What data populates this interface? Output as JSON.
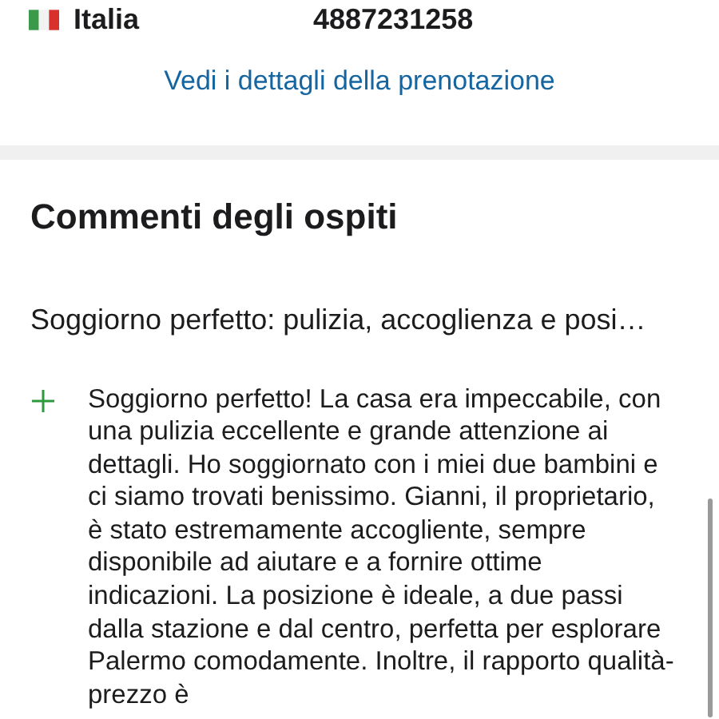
{
  "contact": {
    "country": "Italia",
    "phone": "4887231258"
  },
  "booking_link": "Vedi i dettagli della prenotazione",
  "reviews": {
    "title": "Commenti degli ospiti",
    "items": [
      {
        "headline": "Soggiorno perfetto: pulizia, accoglienza e posi…",
        "expanded": true,
        "body": "Soggiorno perfetto! La casa era impeccabile, con una pulizia eccellente e grande attenzione ai dettagli. Ho soggiornato con i miei due bambini e ci siamo trovati benissimo. Gianni, il proprietario, è stato estremamente accogliente, sempre disponibile ad aiutare e a fornire ottime indicazioni. La posizione è ideale, a due passi dalla stazione e dal centro, perfetta per esplorare Palermo comodamente. Inoltre, il rapporto qualità-prezzo è"
      }
    ]
  }
}
